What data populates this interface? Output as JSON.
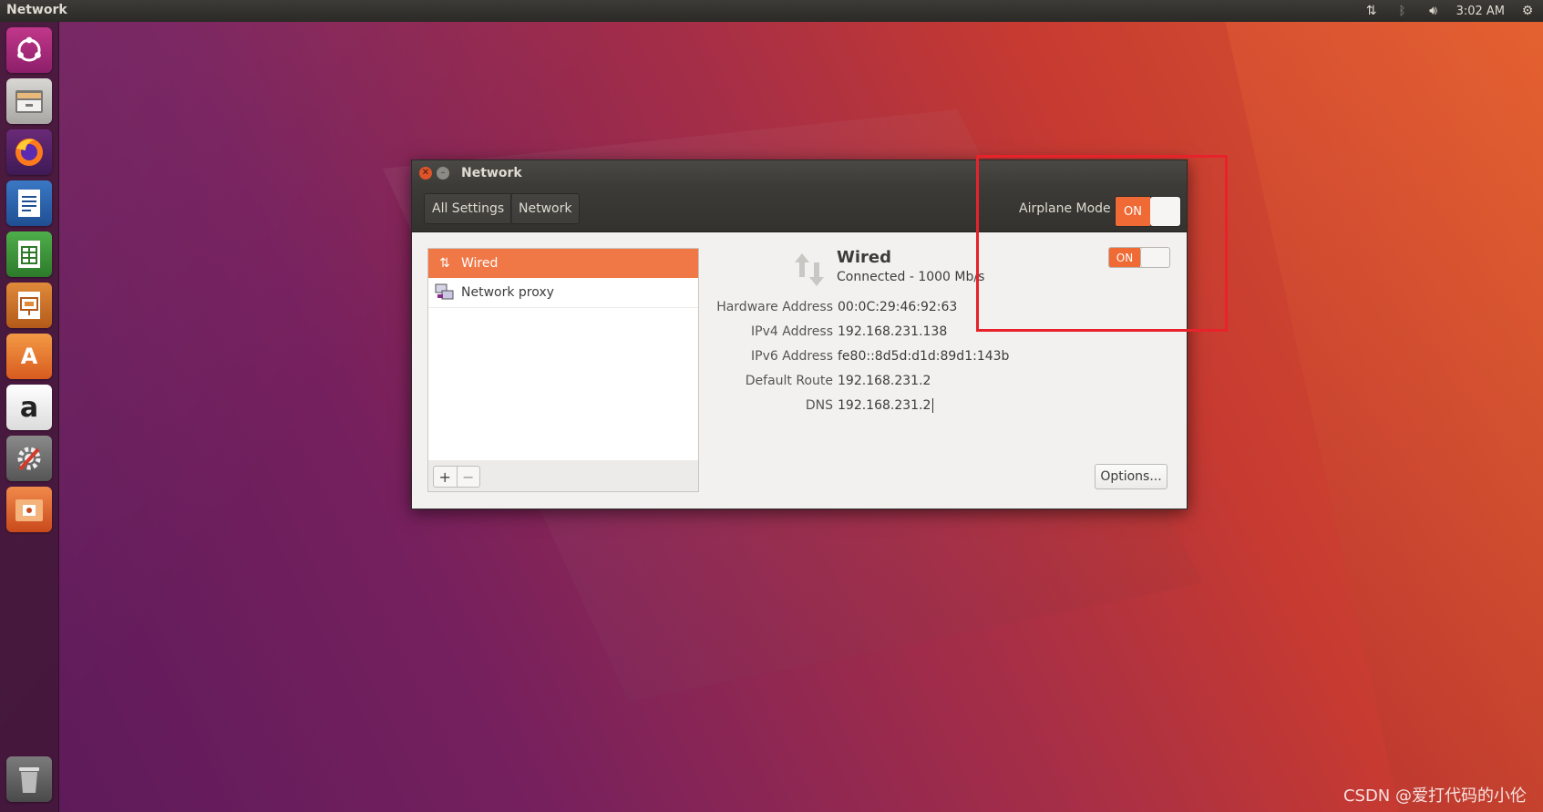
{
  "top_panel": {
    "app_name": "Network",
    "clock": "3:02 AM",
    "indicators": [
      "network-updown-icon",
      "bluetooth-icon",
      "volume-icon",
      "gear-icon"
    ]
  },
  "launcher": {
    "items": [
      "ubuntu-logo",
      "files",
      "firefox",
      "libreoffice-writer",
      "libreoffice-calc",
      "libreoffice-impress",
      "ubuntu-software",
      "amazon",
      "system-settings",
      "software-updater",
      "trash"
    ]
  },
  "window": {
    "title": "Network",
    "toolbar": {
      "all_settings": "All Settings",
      "breadcrumb": "Network",
      "airplane_label": "Airplane Mode",
      "airplane_switch": "ON"
    },
    "list": {
      "items": [
        {
          "label": "Wired",
          "icon": "network-wired-icon",
          "selected": true
        },
        {
          "label": "Network proxy",
          "icon": "network-proxy-icon",
          "selected": false
        }
      ],
      "add": "+",
      "remove": "−"
    },
    "detail": {
      "title": "Wired",
      "status": "Connected - 1000 Mb/s",
      "switch": "ON",
      "properties": [
        {
          "label": "Hardware Address",
          "value": "00:0C:29:46:92:63"
        },
        {
          "label": "IPv4 Address",
          "value": "192.168.231.138"
        },
        {
          "label": "IPv6 Address",
          "value": "fe80::8d5d:d1d:89d1:143b"
        },
        {
          "label": "Default Route",
          "value": "192.168.231.2"
        },
        {
          "label": "DNS",
          "value": "192.168.231.2"
        }
      ],
      "options_button": "Options..."
    }
  },
  "watermark": "CSDN @爱打代码的小伦",
  "colors": {
    "accent": "#f07746",
    "highlight": "#e8222b"
  }
}
